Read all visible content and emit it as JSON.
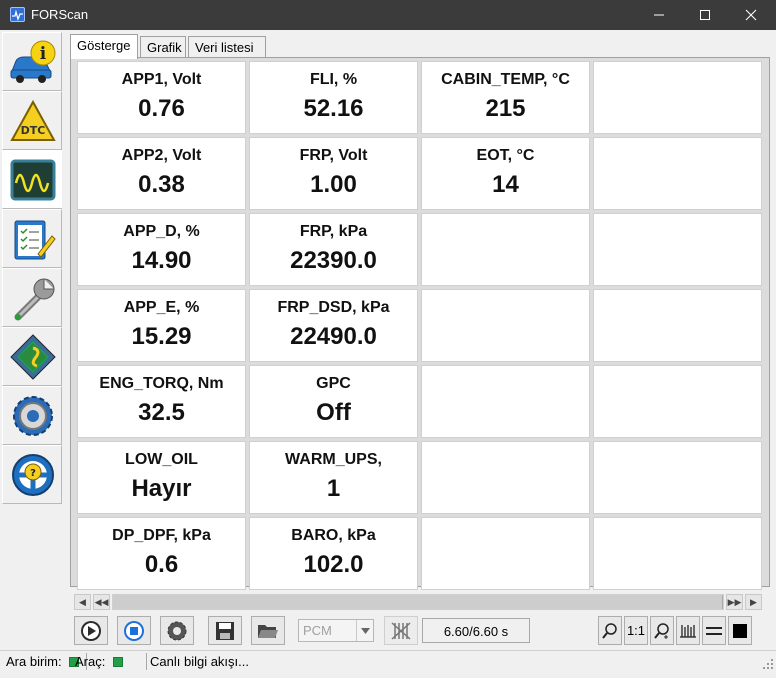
{
  "window": {
    "title": "FORScan"
  },
  "tabs": [
    {
      "label": "Gösterge"
    },
    {
      "label": "Grafik"
    },
    {
      "label": "Veri listesi"
    }
  ],
  "gauges": [
    {
      "label": "APP1, Volt",
      "value": "0.76"
    },
    {
      "label": "FLI, %",
      "value": "52.16"
    },
    {
      "label": "CABIN_TEMP, °C",
      "value": "215"
    },
    {
      "label": "",
      "value": ""
    },
    {
      "label": "APP2, Volt",
      "value": "0.38"
    },
    {
      "label": "FRP, Volt",
      "value": "1.00"
    },
    {
      "label": "EOT, °C",
      "value": "14"
    },
    {
      "label": "",
      "value": ""
    },
    {
      "label": "APP_D, %",
      "value": "14.90"
    },
    {
      "label": "FRP, kPa",
      "value": "22390.0"
    },
    {
      "label": "",
      "value": ""
    },
    {
      "label": "",
      "value": ""
    },
    {
      "label": "APP_E, %",
      "value": "15.29"
    },
    {
      "label": "FRP_DSD, kPa",
      "value": "22490.0"
    },
    {
      "label": "",
      "value": ""
    },
    {
      "label": "",
      "value": ""
    },
    {
      "label": "ENG_TORQ, Nm",
      "value": "32.5"
    },
    {
      "label": "GPC",
      "value": "Off"
    },
    {
      "label": "",
      "value": ""
    },
    {
      "label": "",
      "value": ""
    },
    {
      "label": "LOW_OIL",
      "value": "Hayır"
    },
    {
      "label": "WARM_UPS,",
      "value": "1"
    },
    {
      "label": "",
      "value": ""
    },
    {
      "label": "",
      "value": ""
    },
    {
      "label": "DP_DPF, kPa",
      "value": "0.6"
    },
    {
      "label": "BARO, kPa",
      "value": "102.0"
    },
    {
      "label": "",
      "value": ""
    },
    {
      "label": "",
      "value": ""
    }
  ],
  "toolbar": {
    "module_select": "PCM",
    "time": "6.60/6.60 s",
    "zoom_label": "1:1"
  },
  "statusbar": {
    "interface_label": "Ara birim:",
    "vehicle_label": "Araç:",
    "message": "Canlı bilgi akışı..."
  },
  "colors": {
    "titlebar": "#3b3b3b",
    "status_ok": "#23a046",
    "accent_blue": "#1e6fd9"
  }
}
